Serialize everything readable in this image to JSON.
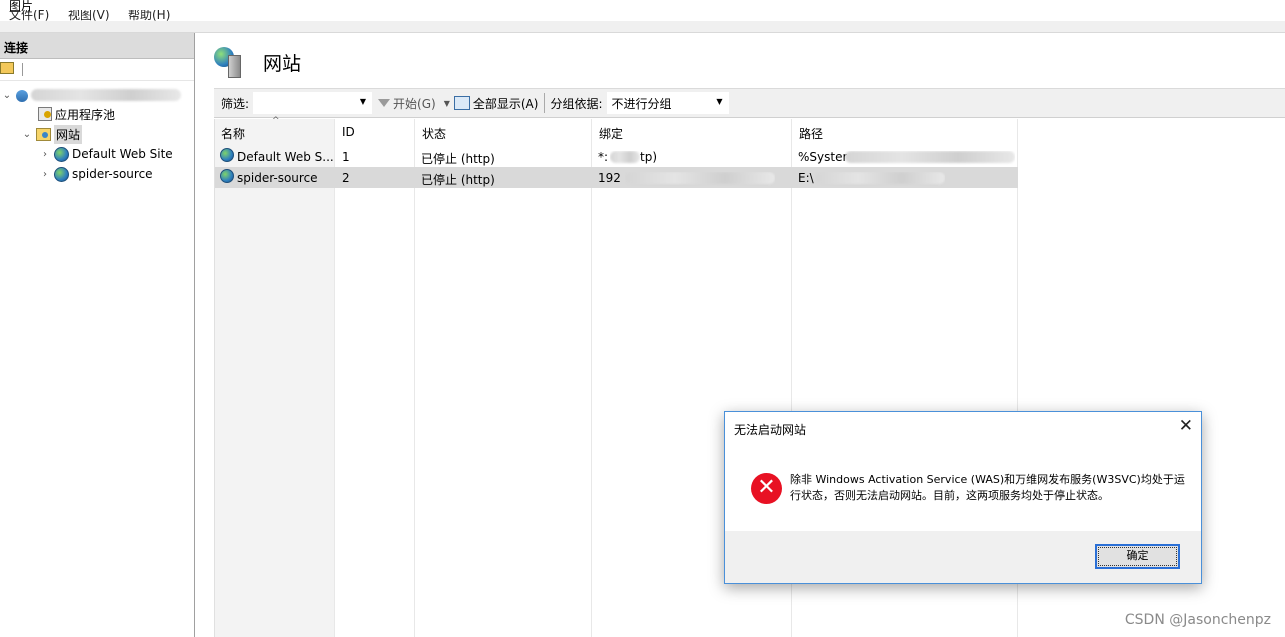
{
  "window": {
    "title_fragment": "图片",
    "menu": [
      "文件(F)",
      "视图(V)",
      "帮助(H)"
    ]
  },
  "connections": {
    "header": "连接",
    "tree": [
      {
        "label": "应用程序池",
        "icon": "app-pool-icon"
      },
      {
        "label": "网站",
        "icon": "sites-folder-icon"
      },
      {
        "label": "Default Web Site",
        "icon": "globe-icon"
      },
      {
        "label": "spider-source",
        "icon": "globe-icon"
      }
    ]
  },
  "main": {
    "title": "网站",
    "filter_label": "筛选:",
    "filter_value": "",
    "start_button": "开始(G)",
    "show_all_button": "全部显示(A)",
    "group_by_label": "分组依据:",
    "group_by_value": "不进行分组",
    "columns": [
      "名称",
      "ID",
      "状态",
      "绑定",
      "路径"
    ],
    "rows": [
      {
        "name": "Default Web S...",
        "id": "1",
        "status": "已停止 (http)",
        "binding": "*:",
        "binding_tail": "tp)",
        "path": "%Syster"
      },
      {
        "name": "spider-source",
        "id": "2",
        "status": "已停止 (http)",
        "binding": "192",
        "binding_tail": "",
        "path": "E:\\"
      }
    ]
  },
  "dialog": {
    "title": "无法启动网站",
    "message": "除非 Windows Activation Service (WAS)和万维网发布服务(W3SVC)均处于运行状态，否则无法启动网站。目前，这两项服务均处于停止状态。",
    "ok_label": "确定",
    "error_color": "#e81123"
  },
  "watermark": "CSDN @Jasonchenpz"
}
